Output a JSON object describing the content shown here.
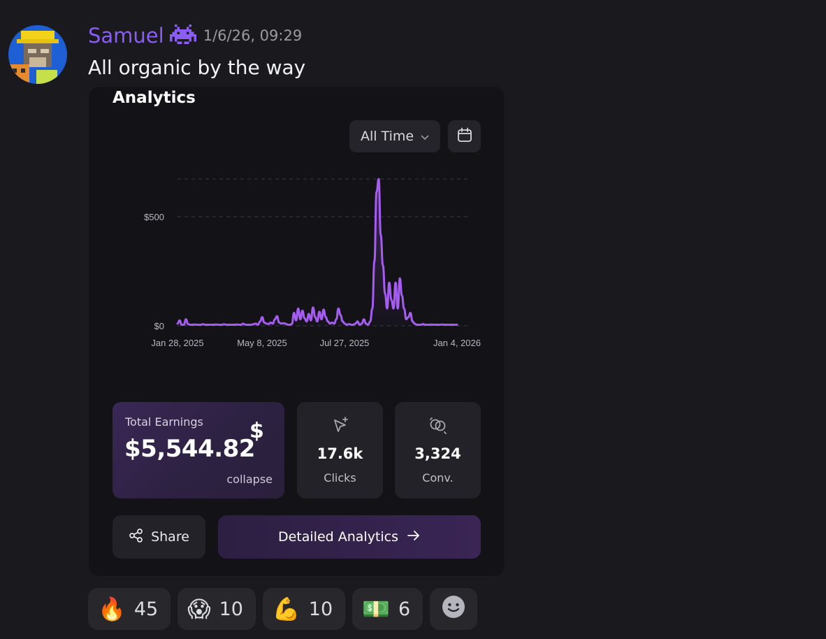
{
  "message": {
    "username": "Samuel",
    "badge_icon": "space-invader-icon",
    "timestamp": "1/6/26, 09:29",
    "text": "All organic by the way"
  },
  "card": {
    "title": "Analytics",
    "range_label": "All Time",
    "calendar_icon": "calendar-icon"
  },
  "chart_data": {
    "type": "line",
    "title": "",
    "xlabel": "",
    "ylabel": "",
    "x_ticks": [
      "Jan 28, 2025",
      "May 8, 2025",
      "Jul 27, 2025",
      "Jan 4, 2026"
    ],
    "y_ticks": [
      "$0",
      "$500"
    ],
    "ylim": [
      0,
      680
    ],
    "grid": "horizontal dashed",
    "color": "#a55cf0",
    "series": [
      {
        "values": [
          10,
          25,
          5,
          5,
          30,
          8,
          5,
          5,
          6,
          5,
          5,
          5,
          7,
          5,
          5,
          5,
          5,
          5,
          6,
          5,
          5,
          5,
          7,
          5,
          5,
          5,
          5,
          5,
          6,
          5,
          5,
          10,
          5,
          5,
          5,
          5,
          8,
          10,
          5,
          20,
          40,
          15,
          10,
          8,
          15,
          10,
          30,
          45,
          15,
          10,
          12,
          10,
          5,
          5,
          8,
          60,
          25,
          80,
          30,
          70,
          35,
          20,
          55,
          25,
          85,
          40,
          20,
          65,
          30,
          75,
          40,
          20,
          10,
          15,
          10,
          30,
          80,
          50,
          20,
          10,
          5,
          8,
          5,
          5,
          10,
          20,
          5,
          10,
          30,
          10,
          5,
          20,
          80,
          300,
          620,
          680,
          420,
          280,
          150,
          80,
          200,
          120,
          80,
          200,
          80,
          220,
          140,
          80,
          30,
          40,
          60,
          20,
          10,
          5,
          5,
          5,
          8,
          5,
          5,
          5,
          6,
          5,
          5,
          5,
          5,
          6,
          5,
          5,
          5,
          5,
          5,
          5,
          5
        ]
      }
    ]
  },
  "stats": {
    "earnings_label": "Total Earnings",
    "earnings_value": "$5,544.82",
    "earnings_symbol": "$",
    "earnings_action": "collapse",
    "clicks_value": "17.6k",
    "clicks_label": "Clicks",
    "conv_value": "3,324",
    "conv_label": "Conv."
  },
  "actions": {
    "share_label": "Share",
    "detail_label": "Detailed Analytics"
  },
  "reactions": [
    {
      "emoji": "🔥",
      "count": "45"
    },
    {
      "emoji": "😱",
      "count": "10"
    },
    {
      "emoji": "💪",
      "count": "10"
    },
    {
      "emoji": "💵",
      "count": "6"
    }
  ]
}
